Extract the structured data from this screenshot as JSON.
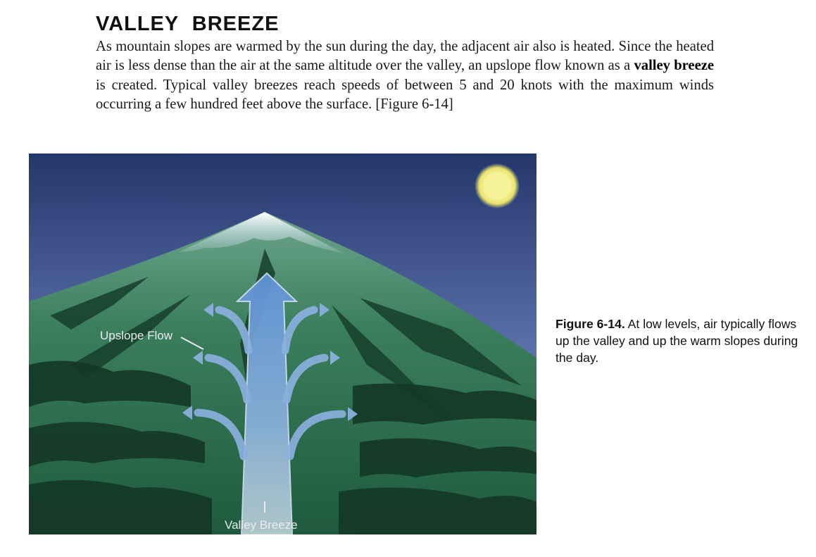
{
  "heading": "VALLEY BREEZE",
  "paragraph": {
    "part1": "As mountain slopes are warmed by the sun during the day, the adjacent air also is heated. Since the heated air is less dense than the air at the same altitude over the valley, an upslope flow known as a ",
    "term": "valley breeze",
    "part2": " is created. Typical valley breezes reach speeds of between 5 and 20 knots with the maximum winds occurring a few hundred feet above the surface. [Figure 6-14]"
  },
  "figure": {
    "label_upslope": "Upslope Flow",
    "label_valley": "Valley Breeze"
  },
  "caption": {
    "number": "Figure 6-14.",
    "text": " At low levels, air typically flows up the valley and up the warm slopes during the day."
  },
  "colors": {
    "sky_top": "#26396f",
    "sky_bottom": "#7d90c4",
    "mountain": "#2f6f4f",
    "snow": "#e8f0f6",
    "sun": "#f3f08c",
    "arrow": "#7aa2d6"
  }
}
